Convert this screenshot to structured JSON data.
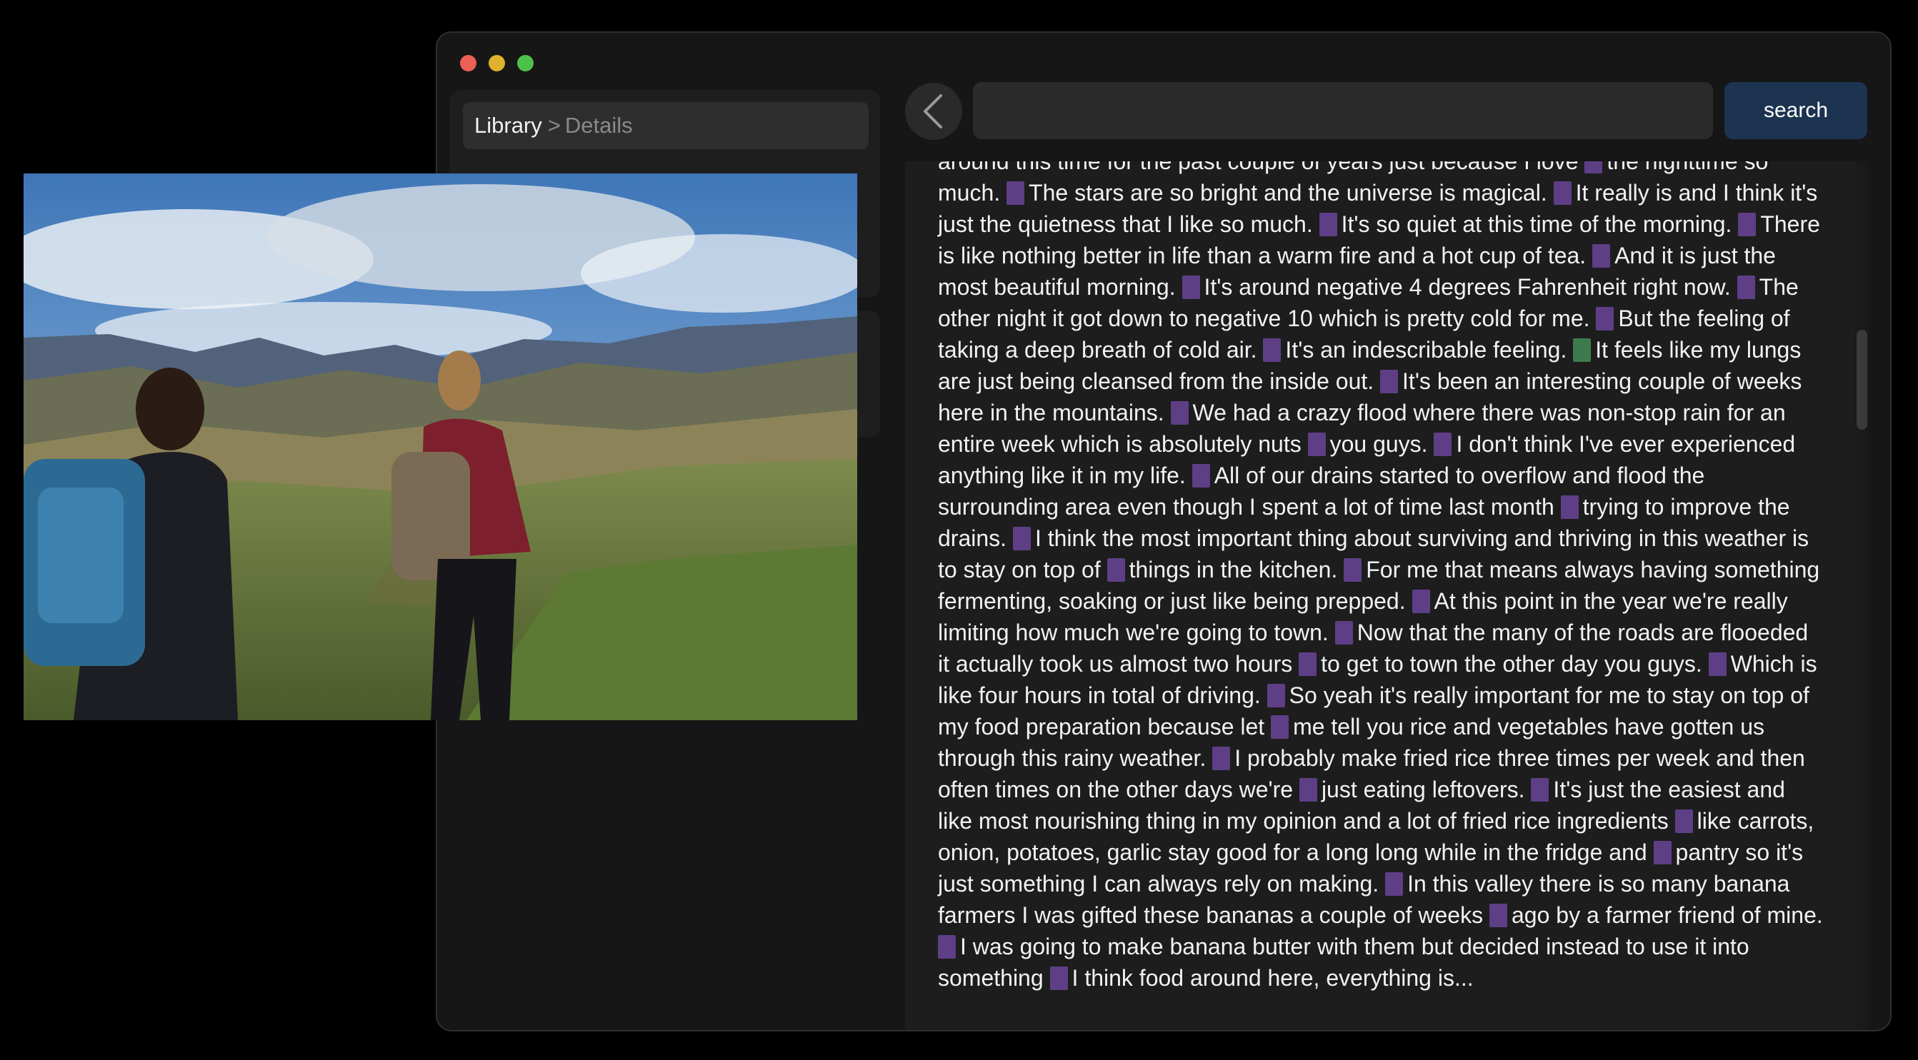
{
  "window": {
    "breadcrumb": {
      "root": "Library",
      "separator": ">",
      "current": "Details"
    }
  },
  "search": {
    "value": "",
    "placeholder": "",
    "button_label": "search"
  },
  "transcript": {
    "segments": [
      "around this time for the past couple of years just because I love",
      "the nighttime so much.",
      "The stars are so bright and the universe is magical.",
      "It really is and I think it's just the quietness that I like so much.",
      "It's so quiet at this time of the morning.",
      "There is like nothing better in life than a warm fire and a hot cup of tea.",
      "And it is just the most beautiful morning.",
      "It's around negative 4 degrees Fahrenheit right now.",
      "The other night it got down to negative 10 which is pretty cold for me.",
      "But the feeling of taking a deep breath of cold air.",
      "It's an indescribable feeling.",
      "It feels like my lungs are just being cleansed from the inside out.",
      "It's been an interesting couple of weeks here in the mountains.",
      "We had a crazy flood where there was non-stop rain for an entire week which is absolutely nuts",
      "you guys.",
      "I don't think I've ever experienced anything like it in my life.",
      "All of our drains started to overflow and flood the surrounding area even though I spent a lot of time last month",
      "trying to improve the drains.",
      "I think the most important thing about surviving and thriving in this weather is to stay on top of",
      "things in the kitchen.",
      "For me that means always having something fermenting, soaking or just like being prepped.",
      "At this point in the year we're really limiting how much we're going to town.",
      "Now that the many of the roads are flooeded it actually took us almost two hours",
      "to get to town the other day you guys.",
      "Which is like four hours in total of driving.",
      "So yeah it's really important for me to stay on top of my food preparation because let",
      "me tell you rice and vegetables have gotten us through this rainy weather.",
      "I probably make fried rice three times per week and then often times on the other days we're",
      "just eating leftovers.",
      "It's just the easiest and like most nourishing thing in my opinion and a lot of fried rice ingredients",
      "like carrots, onion, potatoes, garlic stay good for a long long while in the fridge and",
      "pantry so it's just something I can always rely on making.",
      "In this valley there is so many banana farmers I was gifted these bananas a couple of weeks",
      "ago by a farmer friend of mine.",
      "I was going to make banana butter with them but decided instead to use it into something",
      "I think food around here, everything is..."
    ],
    "active_segment": 11
  },
  "photo": {
    "subject": "two hikers with backpacks walking toward mountains"
  },
  "colors": {
    "window_bg": "#161616",
    "search_button": "#1c3450",
    "segment_marker": "#5e3f86",
    "active_marker": "#3d7a4e"
  },
  "icons": {
    "back": "chevron-left-icon"
  }
}
